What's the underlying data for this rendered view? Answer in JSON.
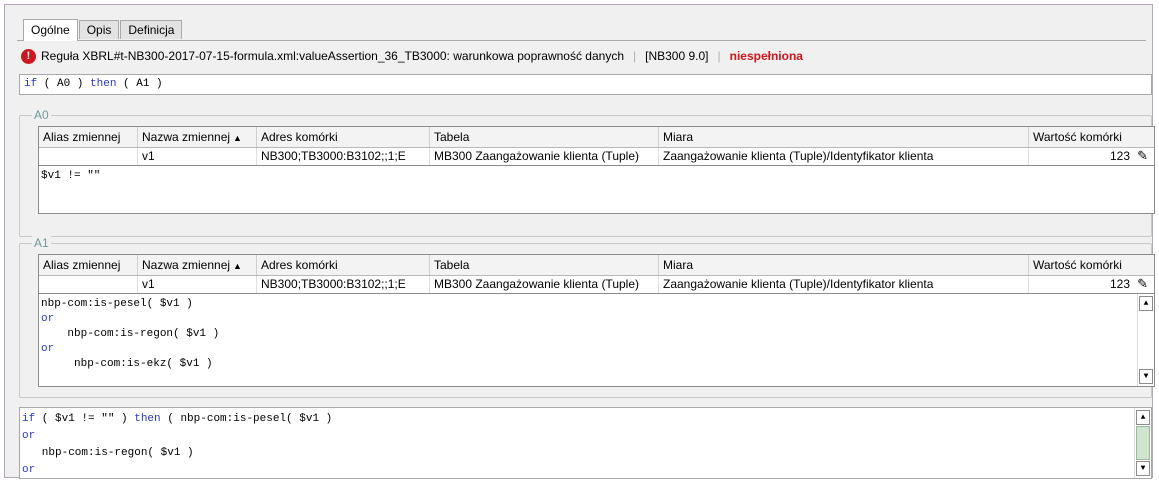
{
  "tabs": [
    {
      "label": "Ogólne",
      "active": true
    },
    {
      "label": "Opis",
      "active": false
    },
    {
      "label": "Definicja",
      "active": false
    }
  ],
  "rule": {
    "icon": "error-icon",
    "text": "Reguła XBRL#t-NB300-2017-07-15-formula.xml:valueAssertion_36_TB3000: warunkowa poprawność danych",
    "code": "[NB300 9.0]",
    "status": "niespełniona",
    "status_color": "#d0161b"
  },
  "main_expression": {
    "if_kw": "if",
    "a0": " ( A0 ) ",
    "then_kw": "then",
    "a1": " ( A1 )"
  },
  "columns": {
    "alias": "Alias zmiennej",
    "name": "Nazwa zmiennej",
    "address": "Adres komórki",
    "table": "Tabela",
    "measure": "Miara",
    "value": "Wartość komórki"
  },
  "groups": [
    {
      "title": "A0",
      "row": {
        "alias": "",
        "name": "v1",
        "address": "NB300;TB3000:B3102;;1;E",
        "table": "MB300 Zaangażowanie klienta (Tuple)",
        "measure": "Zaangażowanie klienta (Tuple)/Identyfikator klienta",
        "value": "123"
      },
      "condition": [
        "$v1 != \"\""
      ]
    },
    {
      "title": "A1",
      "row": {
        "alias": "",
        "name": "v1",
        "address": "NB300;TB3000:B3102;;1;E",
        "table": "MB300 Zaangażowanie klienta (Tuple)",
        "measure": "Zaangażowanie klienta (Tuple)/Identyfikator klienta",
        "value": "123"
      },
      "condition": [
        "nbp-com:is-pesel( $v1 )",
        "or",
        "    nbp-com:is-regon( $v1 )",
        "or",
        "     nbp-com:is-ekz( $v1 )"
      ]
    }
  ],
  "resolved_expression": {
    "line1_if": "if",
    "line1_cond": " ( $v1 != \"\" ) ",
    "line1_then": "then",
    "line1_rest": " ( nbp-com:is-pesel( $v1 )",
    "line2": "or",
    "line3": "   nbp-com:is-regon( $v1 )",
    "line4": "or"
  },
  "colors": {
    "keyword": "#2a38d4",
    "group_title": "#6f9a9a",
    "error": "#d0161b"
  }
}
